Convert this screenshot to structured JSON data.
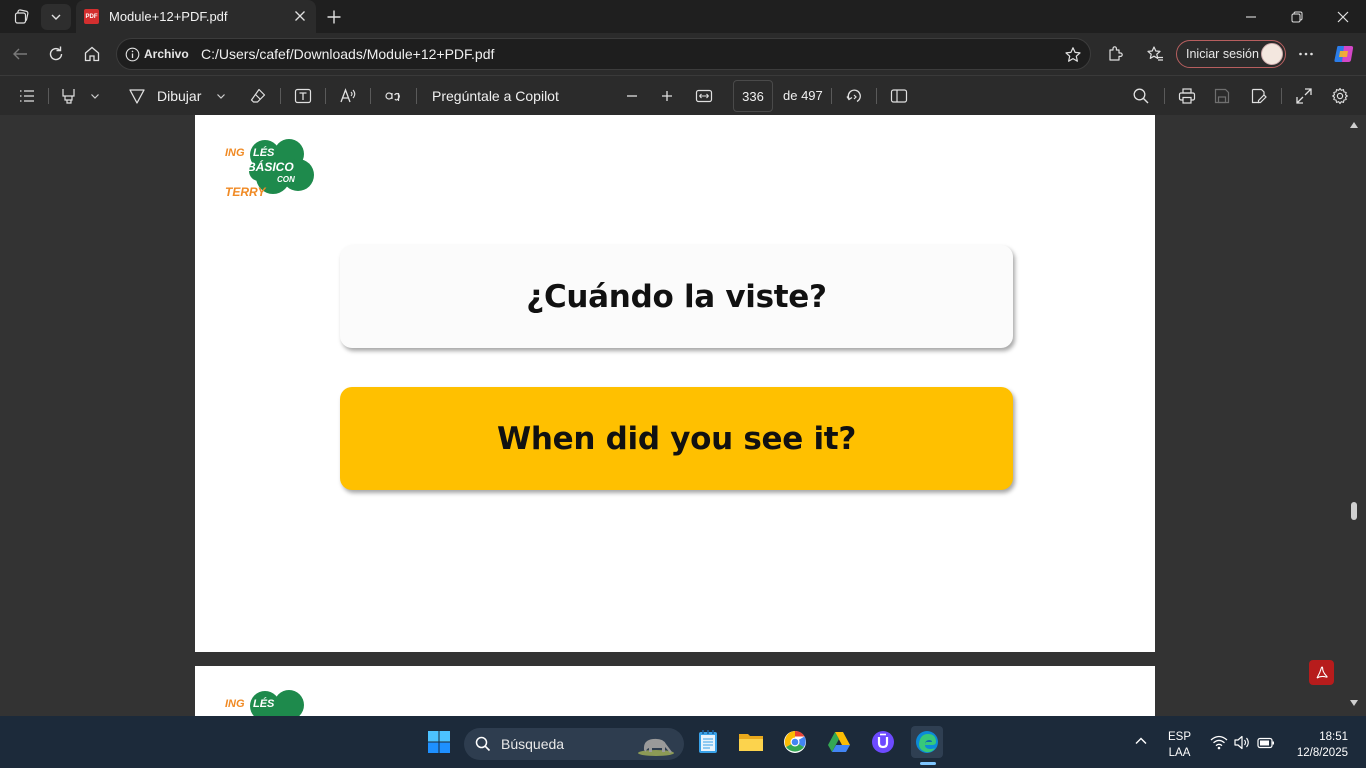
{
  "browser": {
    "tab_title": "Module+12+PDF.pdf",
    "site_label": "Archivo",
    "url": "C:/Users/cafef/Downloads/Module+12+PDF.pdf",
    "signin_label": "Iniciar sesión",
    "pdf_badge": "PDF"
  },
  "pdf_toolbar": {
    "draw_label": "Dibujar",
    "copilot_label": "Pregúntale a Copilot",
    "page_current": "336",
    "page_total": "de 497"
  },
  "document": {
    "logo_words": [
      "INGLÉS",
      "BÁSICO",
      "CON",
      "TERRY"
    ],
    "logo": {
      "w1": "ING",
      "w2": "LÉS",
      "w3": "BÁSICO",
      "w4": "TERRY",
      "w5": "CON"
    },
    "card_spanish": "¿Cuándo la viste?",
    "card_english": "When did you see it?",
    "card_english_color": "#ffc000"
  },
  "taskbar": {
    "search_label": "Búsqueda",
    "lang_top": "ESP",
    "lang_bottom": "LAA",
    "time": "18:51",
    "date": "12/8/2025"
  },
  "colors": {
    "titlebar": "#1f1f1f",
    "toolbar": "#2b2b2b",
    "viewer_bg": "#333333",
    "taskbar": "#1c2a3a",
    "logo_green": "#1e8a4c",
    "logo_orange": "#f08a24"
  }
}
